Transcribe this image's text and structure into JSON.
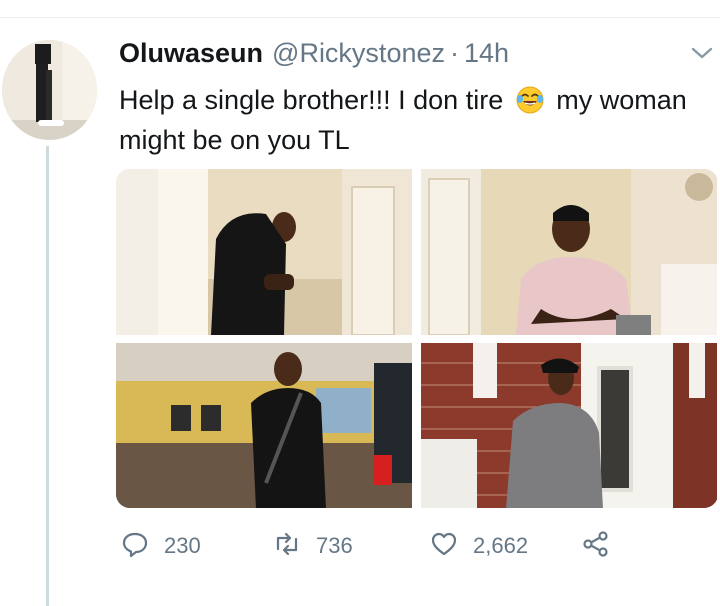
{
  "tweet": {
    "display_name": "Oluwaseun",
    "handle": "@Rickystonez",
    "separator": "·",
    "time": "14h",
    "text_part1": "Help a single brother!!! I don tire",
    "emoji": "face-with-tears-of-joy-emoji",
    "text_part2": "my woman might be on you TL"
  },
  "media": [
    {
      "name": "photo-man-black-sweater-hallway"
    },
    {
      "name": "photo-man-pink-tshirt-seated"
    },
    {
      "name": "photo-man-black-shirt-restaurant"
    },
    {
      "name": "photo-man-grey-sweater-front-door"
    }
  ],
  "actions": {
    "reply_count": "230",
    "retweet_count": "736",
    "like_count": "2,662"
  },
  "colors": {
    "text": "#14171a",
    "secondary": "#657786",
    "thread_line": "#cfd9de",
    "divider": "#e6ecf0"
  },
  "icons": [
    "chevron-down-icon",
    "reply-icon",
    "retweet-icon",
    "like-icon",
    "share-icon"
  ]
}
